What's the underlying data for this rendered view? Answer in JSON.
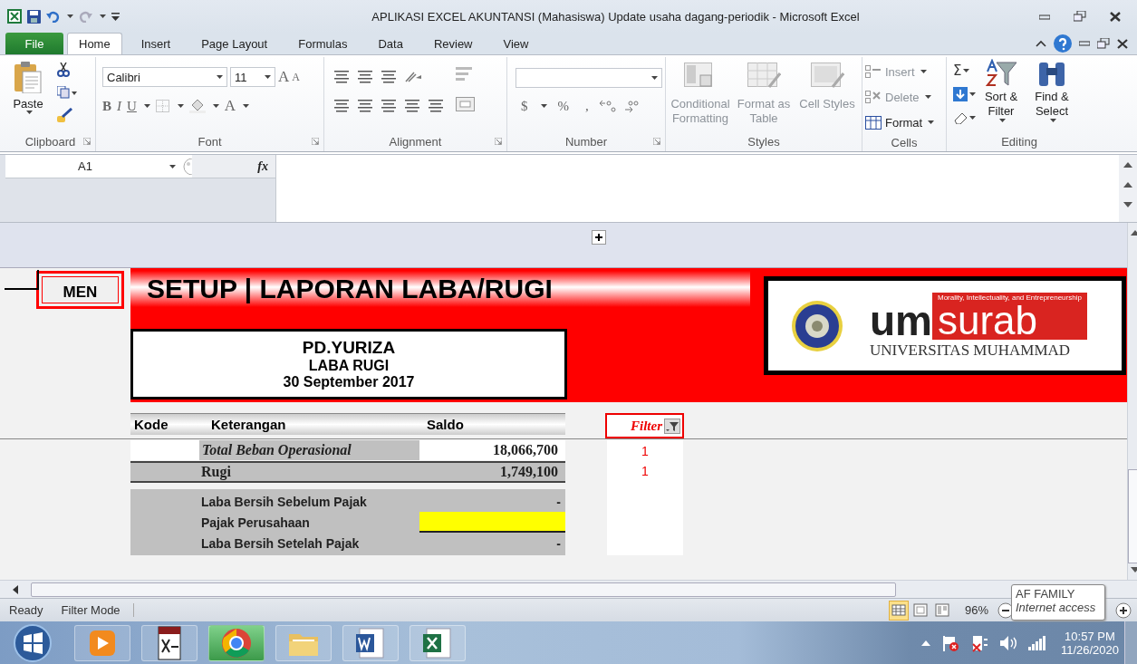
{
  "window": {
    "title": "APLIKASI EXCEL AKUNTANSI (Mahasiswa) Update usaha dagang-periodik  -  Microsoft Excel"
  },
  "tabs": [
    {
      "label": "File",
      "kind": "file",
      "selected": false
    },
    {
      "label": "Home",
      "kind": "tab",
      "selected": true
    },
    {
      "label": "Insert",
      "kind": "tab",
      "selected": false
    },
    {
      "label": "Page Layout",
      "kind": "tab",
      "selected": false
    },
    {
      "label": "Formulas",
      "kind": "tab",
      "selected": false
    },
    {
      "label": "Data",
      "kind": "tab",
      "selected": false
    },
    {
      "label": "Review",
      "kind": "tab",
      "selected": false
    },
    {
      "label": "View",
      "kind": "tab",
      "selected": false
    }
  ],
  "ribbon": {
    "groups": [
      {
        "kind": "clipboard",
        "label": "Clipboard",
        "paste": "Paste"
      },
      {
        "kind": "font",
        "label": "Font",
        "font_name": "Calibri",
        "font_size": "11",
        "grow": "A",
        "shrink": "A",
        "styles": [
          "B",
          "I",
          "U"
        ],
        "font_color": "A"
      },
      {
        "kind": "alignment",
        "label": "Alignment"
      },
      {
        "kind": "number",
        "label": "Number",
        "currency": "$",
        "percent": "%",
        "comma": ","
      },
      {
        "kind": "styles",
        "label": "Styles",
        "buttons": [
          {
            "label": "Conditional Formatting",
            "disabled": true
          },
          {
            "label": "Format as Table",
            "disabled": true
          },
          {
            "label": "Cell Styles",
            "disabled": true
          }
        ]
      },
      {
        "kind": "cells",
        "label": "Cells",
        "buttons": [
          {
            "label": "Insert",
            "disabled": true
          },
          {
            "label": "Delete",
            "disabled": true
          },
          {
            "label": "Format",
            "disabled": false
          }
        ]
      },
      {
        "kind": "editing",
        "label": "Editing",
        "sigma": "Σ",
        "buttons": [
          {
            "label": "Sort & Filter"
          },
          {
            "label": "Find & Select"
          }
        ]
      }
    ]
  },
  "formula_bar": {
    "name_box": "A1",
    "function_label": "fx"
  },
  "sheet": {
    "menu_button": "MEN",
    "title": "SETUP | LAPORAN LABA/RUGI",
    "company": [
      "PD.YURIZA",
      "LABA RUGI",
      "30 September 2017"
    ],
    "logo": {
      "tagline": "Morality, Intellectuality, and Entrepreneurship",
      "mark_left": "um",
      "mark_right": "surab",
      "caption": "UNIVERSITAS MUHAMMAD"
    },
    "table": {
      "columns": [
        "Kode",
        "Keterangan",
        "Saldo"
      ],
      "rows": [
        {
          "kind": "subtotal",
          "label": "Total Beban Operasional",
          "saldo": "18,066,700"
        },
        {
          "kind": "total",
          "label": "Rugi",
          "saldo": "1,749,100"
        },
        {
          "kind": "summary",
          "label": "Laba Bersih Sebelum Pajak",
          "saldo": "-"
        },
        {
          "kind": "input",
          "label": "Pajak Perusahaan"
        },
        {
          "kind": "summary",
          "label": "Laba Bersih Setelah Pajak",
          "saldo": "-"
        }
      ]
    },
    "filter": {
      "label": "Filter",
      "values": [
        "1",
        "1"
      ]
    }
  },
  "status_bar": {
    "items": [
      "Ready",
      "Filter Mode"
    ],
    "views": [
      {
        "kind": "normal",
        "selected": true
      },
      {
        "kind": "layout",
        "selected": false
      },
      {
        "kind": "break",
        "selected": false
      }
    ],
    "zoom": "96%"
  },
  "tooltip": {
    "title": "AF FAMILY",
    "subtitle": "Internet access"
  },
  "taskbar": {
    "apps": [
      {
        "kind": "media",
        "active": false
      },
      {
        "kind": "lisrel",
        "active": false
      },
      {
        "kind": "browser",
        "active": true
      },
      {
        "kind": "folder",
        "active": false
      },
      {
        "kind": "word",
        "active": false
      },
      {
        "kind": "excel",
        "active": false
      }
    ],
    "time": "10:57 PM",
    "date": "11/26/2020"
  }
}
